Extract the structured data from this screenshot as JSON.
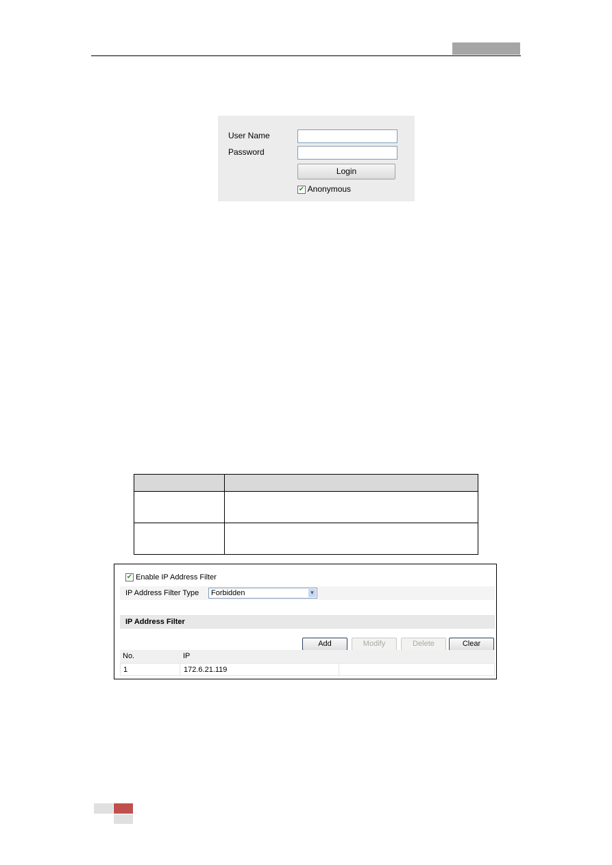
{
  "login": {
    "user_name_label": "User Name",
    "password_label": "Password",
    "user_name_value": "",
    "password_value": "",
    "login_button": "Login",
    "anonymous_label": "Anonymous",
    "anonymous_checked": true
  },
  "ip_filter": {
    "enable_label": "Enable IP Address Filter",
    "enable_checked": true,
    "type_label": "IP Address Filter Type",
    "type_value": "Forbidden",
    "section_title": "IP Address Filter",
    "buttons": {
      "add": "Add",
      "modify": "Modify",
      "delete": "Delete",
      "clear": "Clear"
    },
    "columns": [
      "No.",
      "IP"
    ],
    "rows": [
      {
        "no": "1",
        "ip": "172.6.21.119"
      }
    ]
  },
  "colors": {
    "header_bar": "#a6a6a6",
    "footer_accent": "#c0504d",
    "footer_gray": "#e0e0e0",
    "panel_bg": "#ececec"
  }
}
